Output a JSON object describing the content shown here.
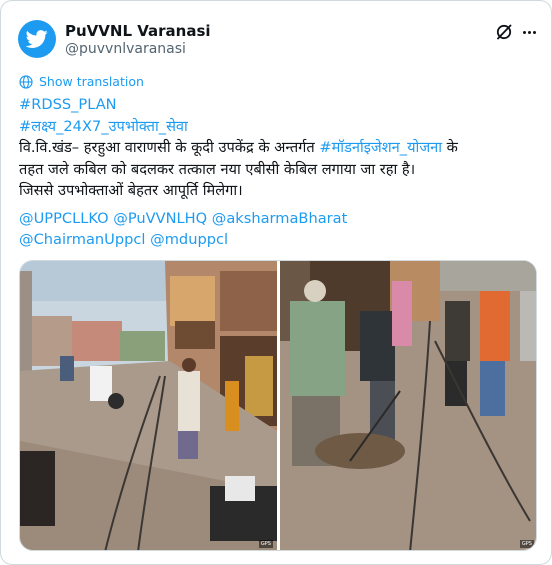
{
  "author": {
    "name": "PuVVNL Varanasi",
    "handle": "@puvvnlvaranasi",
    "avatar_icon": "bird-icon",
    "avatar_color": "#1d9bf0"
  },
  "actions": {
    "grok_icon": "grok-icon",
    "more_icon": "more-icon"
  },
  "translate": {
    "label": "Show translation",
    "icon": "globe-icon"
  },
  "tweet": {
    "hashtag_1": "#RDSS_PLAN",
    "hashtag_2": "#लक्ष्य_24X7_उपभोक्ता_सेवा",
    "line_1_text": "वि.वि.खंड– हरहुआ वाराणसी के कूदी उपकेंद्र के अन्तर्गत ",
    "line_1_tag": "#मॉडर्नाइजेशन_योजना",
    "line_1_tail": " के",
    "line_2": "तहत जले कबिल को बदलकर तत्काल नया एबीसी केबिल लगाया जा रहा है।",
    "line_3": "जिससे उपभोक्ताओं बेहतर आपूर्ति मिलेगा।",
    "mention_1": "@UPPCLLKO",
    "mention_2": "@PuVVNLHQ",
    "mention_3": "@aksharmaBharat",
    "mention_4": "@ChairmanUppcl",
    "mention_5": "@mduppcl"
  },
  "colors": {
    "link": "#1d9bf0",
    "text": "#0f1419",
    "secondary": "#536471",
    "border": "#cfd9de"
  }
}
